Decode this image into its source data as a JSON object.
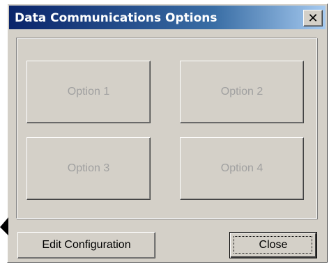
{
  "window": {
    "title": "Data Communications Options",
    "close_glyph": "✕"
  },
  "options": [
    {
      "label": "Option 1",
      "enabled": false
    },
    {
      "label": "Option 2",
      "enabled": false
    },
    {
      "label": "Option 3",
      "enabled": false
    },
    {
      "label": "Option 4",
      "enabled": false
    }
  ],
  "buttons": {
    "edit_configuration": "Edit Configuration",
    "close": "Close"
  },
  "colors": {
    "titlebar_start": "#0a246a",
    "titlebar_end": "#a6caf0",
    "face": "#d4d0c8",
    "disabled_text": "#a0a0a0"
  },
  "icons": {
    "mouse_pointer": "arrow-cursor-icon"
  }
}
